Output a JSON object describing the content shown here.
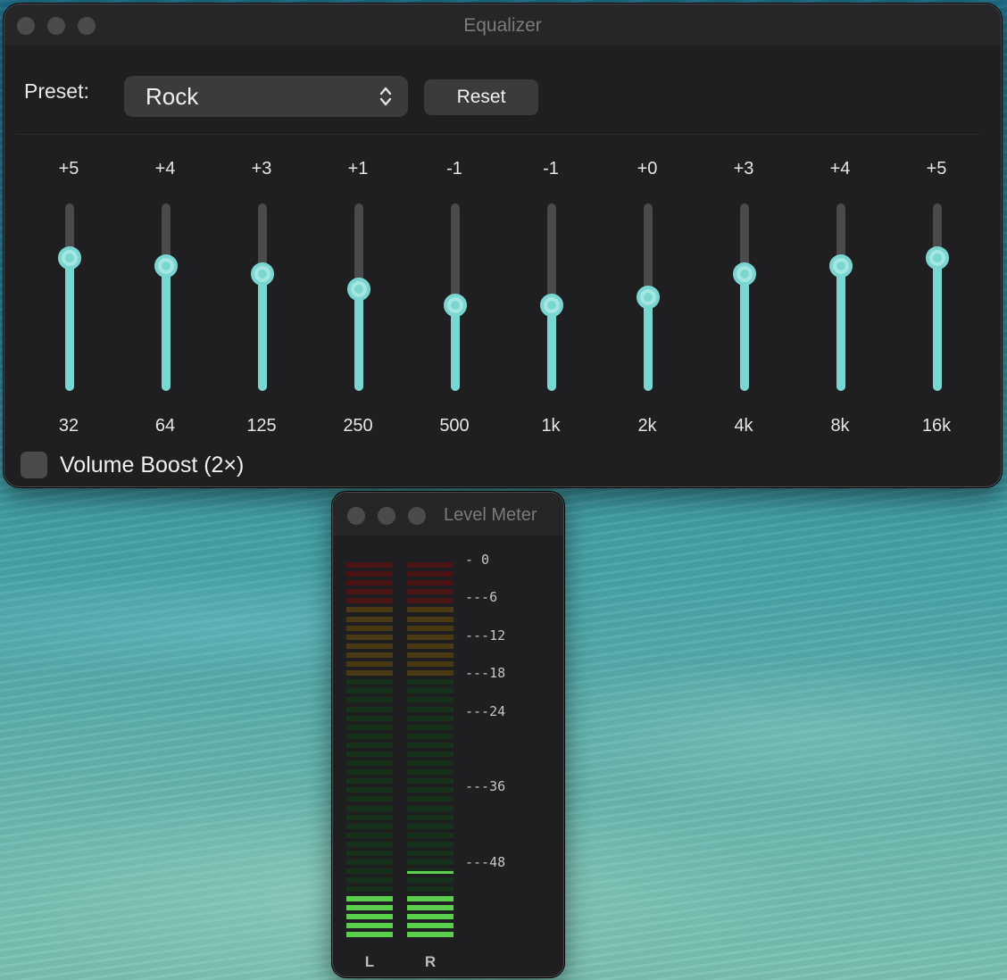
{
  "equalizer": {
    "title": "Equalizer",
    "preset_label": "Preset:",
    "preset_value": "Rock",
    "reset_label": "Reset",
    "bands": [
      {
        "freq": "32",
        "gain_label": "+5",
        "gain": 5
      },
      {
        "freq": "64",
        "gain_label": "+4",
        "gain": 4
      },
      {
        "freq": "125",
        "gain_label": "+3",
        "gain": 3
      },
      {
        "freq": "250",
        "gain_label": "+1",
        "gain": 1
      },
      {
        "freq": "500",
        "gain_label": "-1",
        "gain": -1
      },
      {
        "freq": "1k",
        "gain_label": "-1",
        "gain": -1
      },
      {
        "freq": "2k",
        "gain_label": "+0",
        "gain": 0
      },
      {
        "freq": "4k",
        "gain_label": "+3",
        "gain": 3
      },
      {
        "freq": "8k",
        "gain_label": "+4",
        "gain": 4
      },
      {
        "freq": "16k",
        "gain_label": "+5",
        "gain": 5
      }
    ],
    "volume_boost_label": "Volume Boost (2×)",
    "volume_boost_checked": false,
    "accent_color": "#7ad6d1"
  },
  "level_meter": {
    "title": "Level Meter",
    "scale": [
      "0",
      "-6",
      "-12",
      "-18",
      "-24",
      "-36",
      "-48"
    ],
    "channels": [
      {
        "label": "L",
        "level_db": -54
      },
      {
        "label": "R",
        "level_db": -54,
        "peak_db": -49
      }
    ],
    "colors": {
      "red": "#c0392b",
      "yellow": "#c9a227",
      "green": "#5ccf4f"
    }
  }
}
